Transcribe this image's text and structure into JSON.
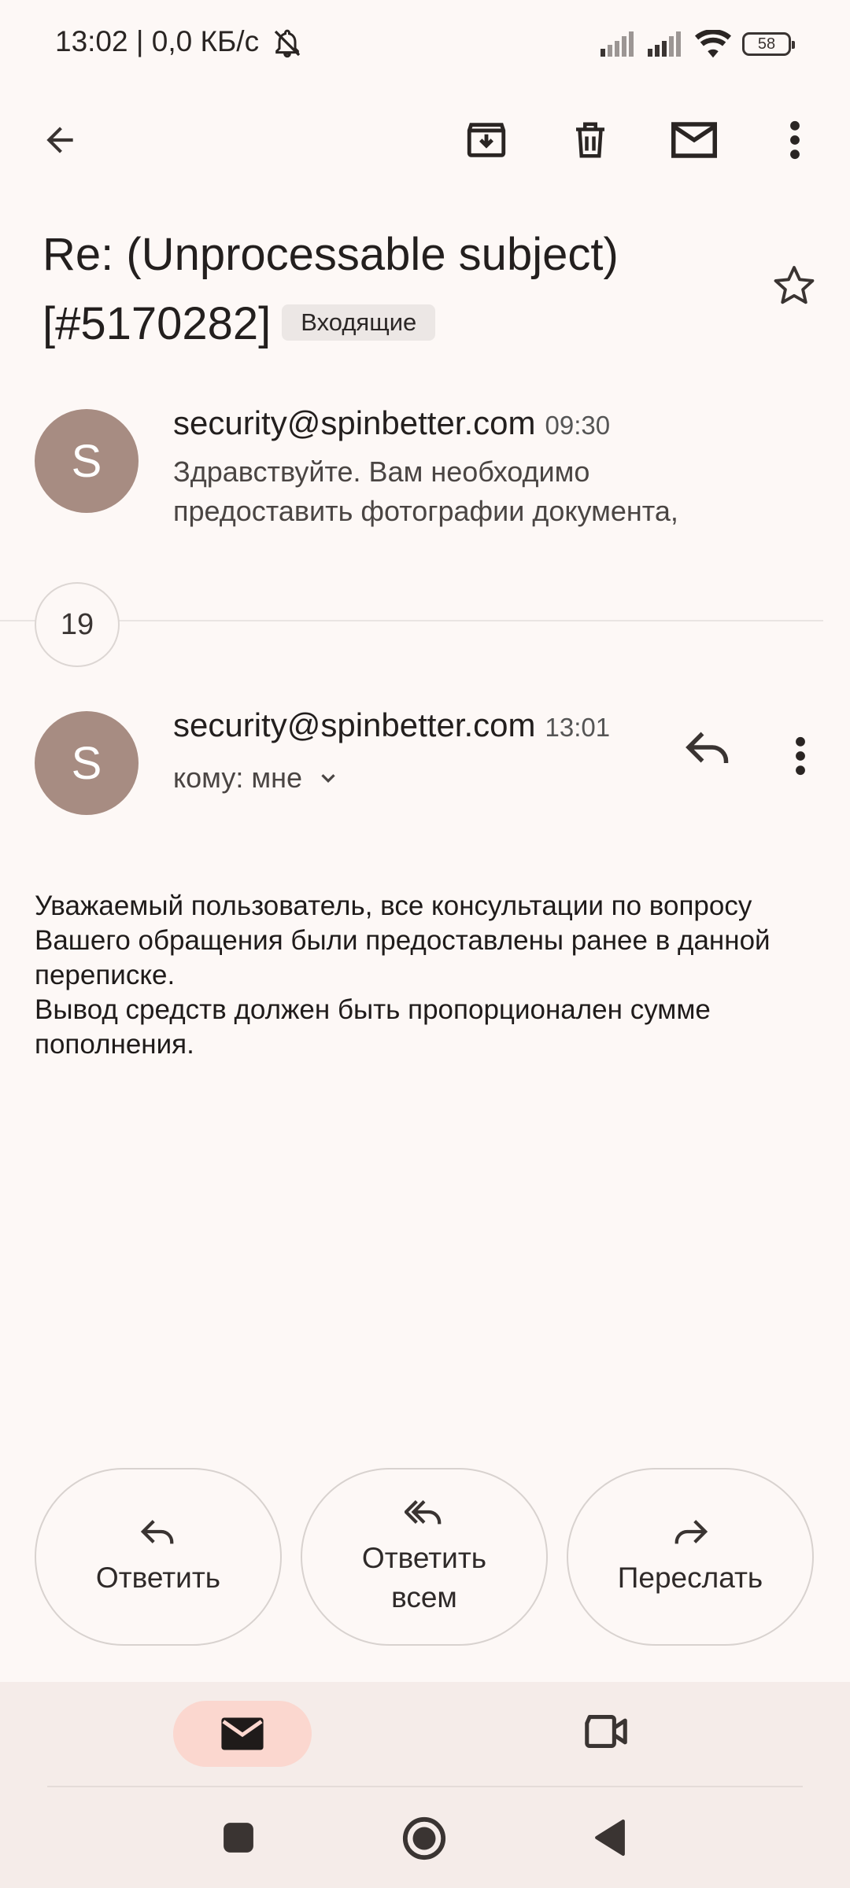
{
  "status_bar": {
    "time_text": "13:02 | 0,0 КБ/с",
    "battery": "58"
  },
  "toolbar": {
    "icons": [
      "back-arrow-icon",
      "archive-icon",
      "delete-icon",
      "mark-unread-icon",
      "more-vert-icon"
    ]
  },
  "subject": {
    "text": "Re: (Unprocessable subject) [#5170282]",
    "label": "Входящие"
  },
  "messages": [
    {
      "avatar_letter": "S",
      "sender": "security@spinbetter.com",
      "time": "09:30",
      "snippet": "Здравствуйте. Вам необходимо предоставить фотографии документа,"
    },
    {
      "avatar_letter": "S",
      "sender": "security@spinbetter.com",
      "time": "13:01",
      "recipient": "кому: мне",
      "body_lines": [
        "Уважаемый пользователь, все консультации по вопросу Вашего обращения были предоставлены ранее в данной переписке.",
        "Вывод средств должен быть пропорционален сумме пополнения."
      ]
    }
  ],
  "collapsed_count": "19",
  "actions": {
    "reply": "Ответить",
    "reply_all": "Ответить всем",
    "forward": "Переслать"
  },
  "colors": {
    "background": "#fdf8f6",
    "avatar": "#a78c82",
    "nav_active": "#fbd7cf"
  }
}
